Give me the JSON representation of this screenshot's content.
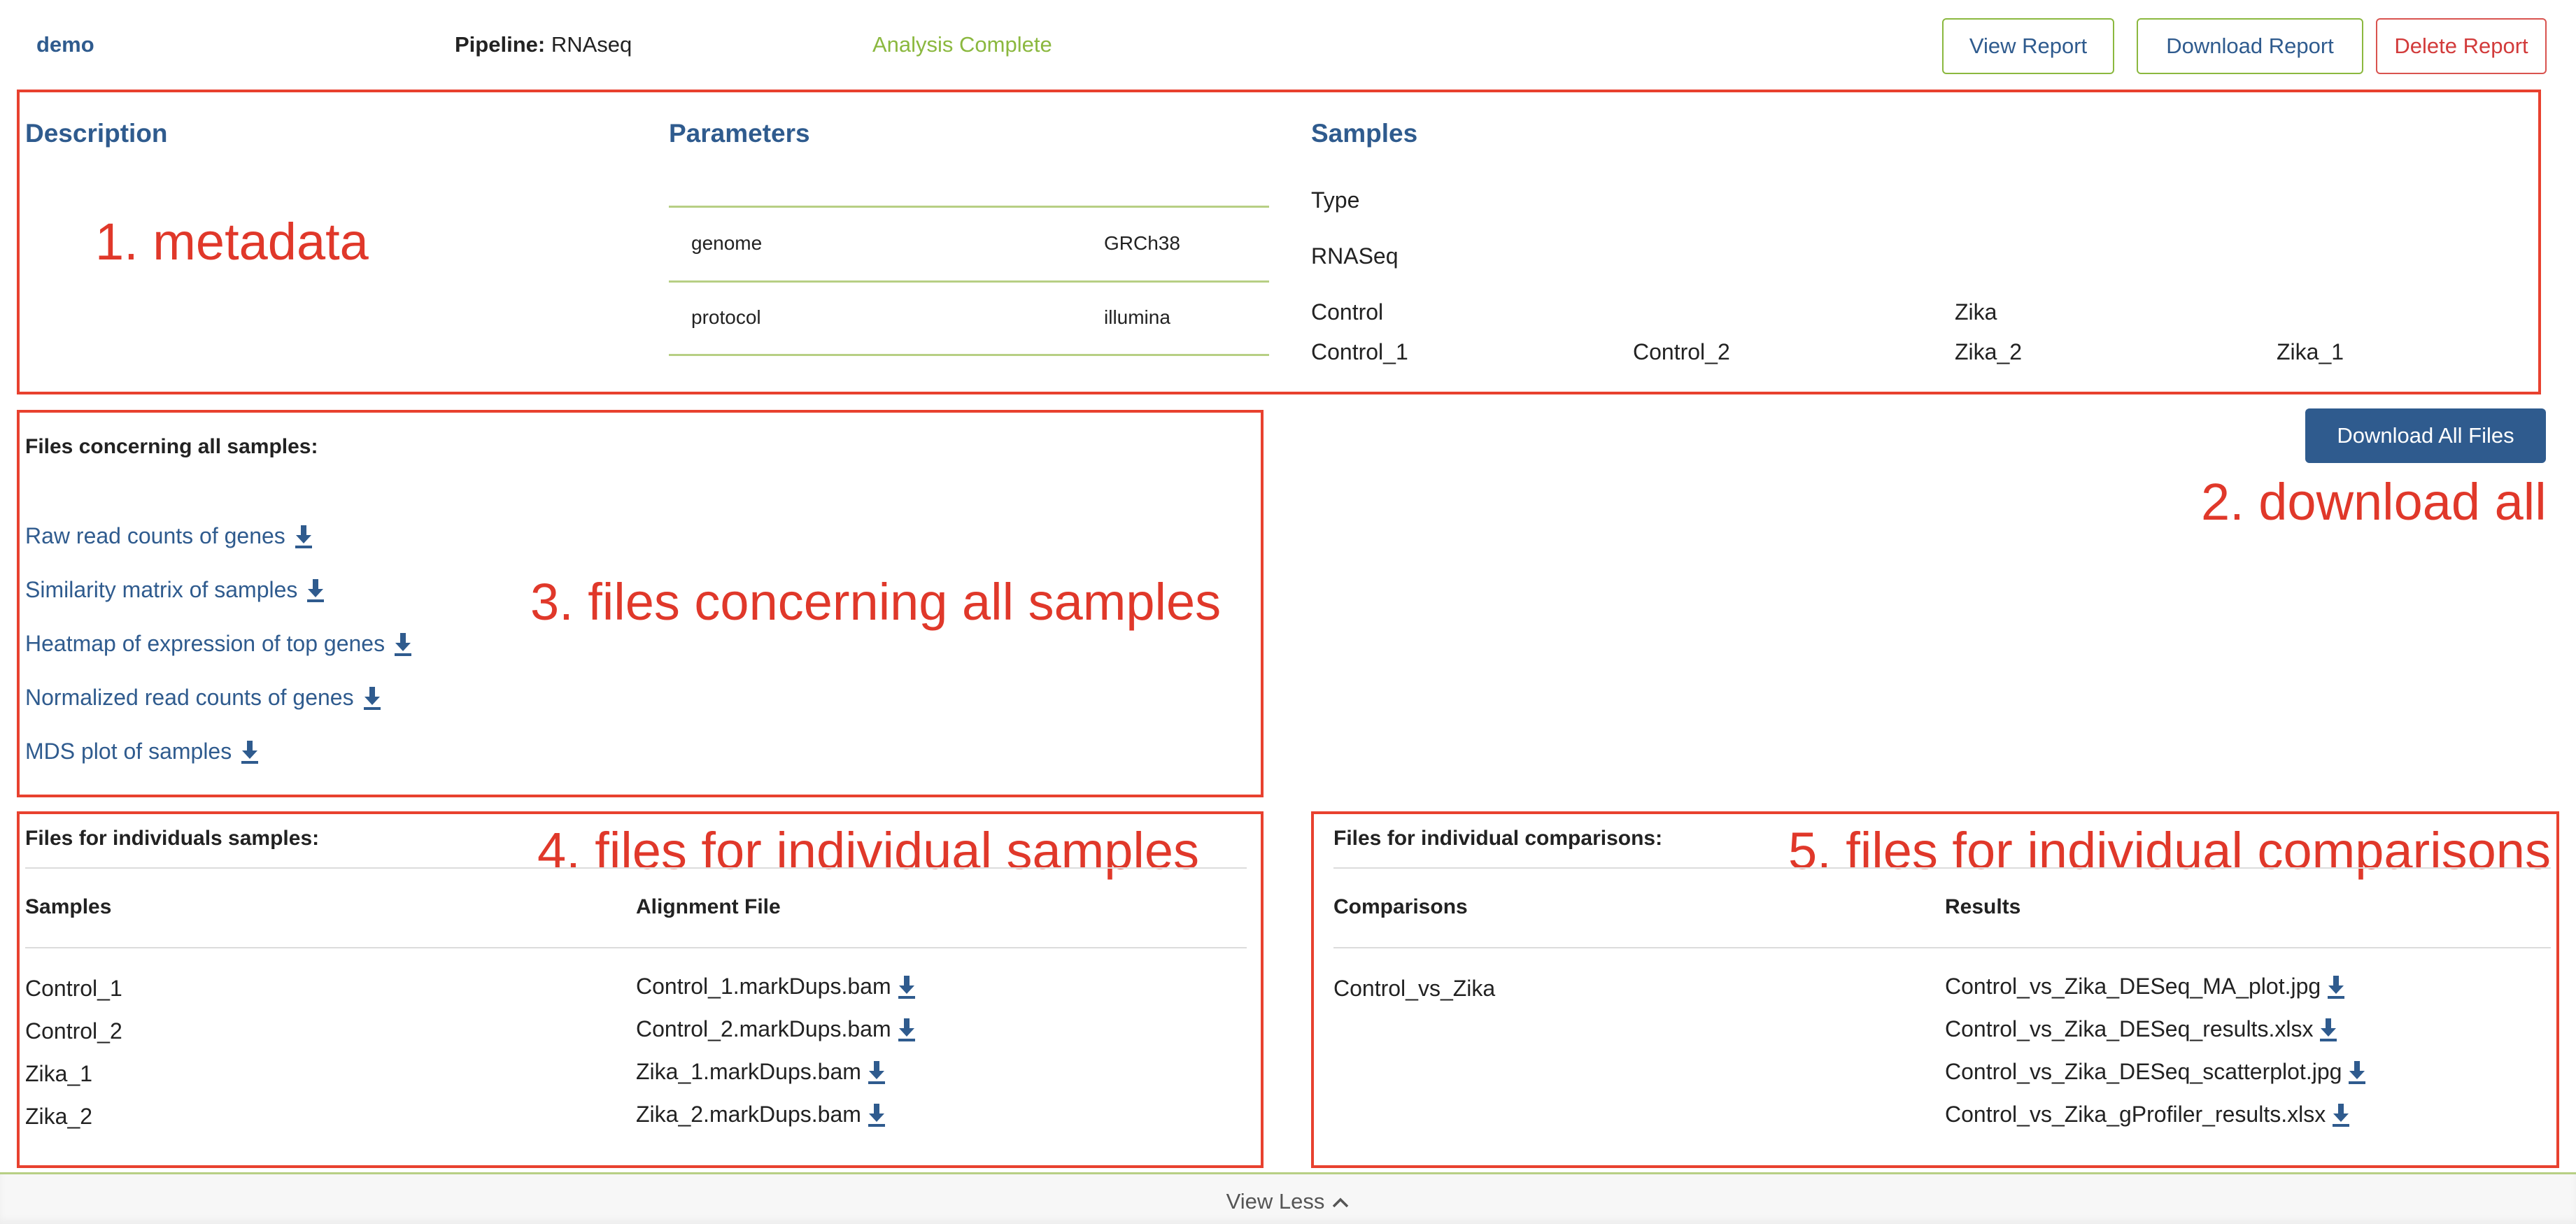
{
  "header": {
    "project": "demo",
    "pipeline_label": "Pipeline:",
    "pipeline_value": "RNAseq",
    "status": "Analysis Complete",
    "view_report": "View Report",
    "download_report": "Download Report",
    "delete_report": "Delete Report"
  },
  "colors": {
    "brand_blue": "#2f5b8e",
    "accent_green": "#8bb83f",
    "danger_red": "#d23b3b",
    "annotation_red": "#e0382a"
  },
  "annotations": {
    "a1": "1. metadata",
    "a2": "2. download all",
    "a3": "3. files concerning all samples",
    "a4": "4. files for individual samples",
    "a5": "5. files for individual comparisons"
  },
  "metadata": {
    "description_title": "Description",
    "parameters_title": "Parameters",
    "samples_title": "Samples",
    "parameters": [
      {
        "key": "genome",
        "value": "GRCh38"
      },
      {
        "key": "protocol",
        "value": "illumina"
      }
    ],
    "samples": {
      "type_label": "Type",
      "type_value": "RNASeq",
      "group_control": "Control",
      "group_zika": "Zika",
      "names": [
        "Control_1",
        "Control_2",
        "Zika_2",
        "Zika_1"
      ]
    }
  },
  "download_all": "Download All Files",
  "all_samples": {
    "title": "Files concerning all samples:",
    "files": [
      "Raw read counts of genes",
      "Similarity matrix of samples",
      "Heatmap of expression of top genes",
      "Normalized read counts of genes",
      "MDS plot of samples"
    ]
  },
  "individual_samples": {
    "title": "Files for individuals samples:",
    "col_samples": "Samples",
    "col_alignment": "Alignment File",
    "rows": [
      {
        "sample": "Control_1",
        "file": "Control_1.markDups.bam"
      },
      {
        "sample": "Control_2",
        "file": "Control_2.markDups.bam"
      },
      {
        "sample": "Zika_1",
        "file": "Zika_1.markDups.bam"
      },
      {
        "sample": "Zika_2",
        "file": "Zika_2.markDups.bam"
      }
    ]
  },
  "comparisons": {
    "title": "Files for individual comparisons:",
    "col_comparisons": "Comparisons",
    "col_results": "Results",
    "comparison": "Control_vs_Zika",
    "results": [
      "Control_vs_Zika_DESeq_MA_plot.jpg",
      "Control_vs_Zika_DESeq_results.xlsx",
      "Control_vs_Zika_DESeq_scatterplot.jpg",
      "Control_vs_Zika_gProfiler_results.xlsx"
    ]
  },
  "footer": {
    "view_less": "View Less"
  }
}
